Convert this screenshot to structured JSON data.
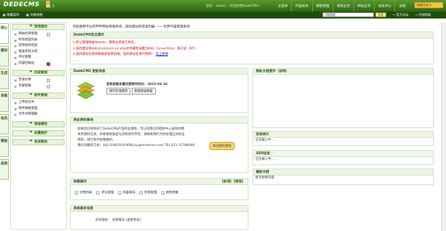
{
  "brand": {
    "logo": "DEDECMS",
    "version": "v5.7",
    "badge": "试用"
  },
  "top": {
    "welcome": "您好：admin，欢迎使用DedeCMS！",
    "nav": [
      "主菜单",
      "内容发布",
      "模板管理",
      "系统主页",
      "网站主页",
      "会员中心",
      "注销"
    ],
    "quick": "快捷方式"
  },
  "bar2": {
    "hide_menu": "隐藏菜单",
    "sitemap": "功能地图",
    "search_placeholder": "功能搜索",
    "search_btn": "搜索",
    "forum": "官方论坛",
    "help": "在线帮助"
  },
  "tabs": [
    "核心",
    "模块",
    "生成",
    "采集",
    "会员",
    "模板",
    "系统"
  ],
  "sidebar": {
    "groups": [
      {
        "title": "常用操作",
        "items": [
          "网站栏目管理",
          "所有档案列表",
          "等审核的档案",
          "我发布的文档",
          "评论管理",
          "内容回收站"
        ]
      },
      {
        "title": "内容管理",
        "items": [
          "普通文章",
          "专题管理"
        ]
      },
      {
        "title": "附件管理",
        "items": [
          "上传新文件",
          "附件数据管理",
          "文件式管理器"
        ]
      },
      {
        "title": "频道模型",
        "items": []
      },
      {
        "title": "批量维护",
        "items": []
      },
      {
        "title": "系统帮助",
        "items": []
      }
    ]
  },
  "main": {
    "welcome": "欢迎使用专业的PHP网站管理系统，轻松建站的首选利器 —— 织梦内容管理系统",
    "security": {
      "title": "DedeCMS安全提示",
      "lines": [
        "1.默认管理目录为dede，需要立即将它更名；",
        "2.强烈建议将data/common.inc.php文件属性设置为644（Linux/Unix）或只读（NT）；",
        "3.强烈建议您修改数据表名称前缀，强烈建议您进行更改！"
      ],
      "link": "马上修改"
    },
    "update": {
      "title": "DedeCMS 更新消息",
      "date_text": "您系统版本最后更新时间为：2015-06-18",
      "btn_update": "进行在线更新",
      "btn_fix": "系统错误修复"
    },
    "license": {
      "title": "商业授权查询",
      "lines": [
        "如果您已经购买了DedeCMS产品商业授权，可以在我们的授权中心查询到相",
        "关的授权信息，如果授权类型与您购买的不符，请联系我们为你办理正式商业",
        "授权，进行及时处理维护。",
        "我们的联系方式：QQ:10387919 MSN:jsy@dedecms.com TEL:021-37788569"
      ],
      "btn": "商业授权查询"
    },
    "quick": {
      "title": "快捷操作",
      "actions": "【新增】【管理】",
      "links": [
        "文档列表",
        "评论管理",
        "内容发布",
        "栏目管理",
        "修改参数"
      ]
    },
    "sysinfo": {
      "title": "系统基本信息",
      "line": "您的级别： 总管理员 [查看更多]"
    },
    "right": {
      "help_title": "帮助文档提示（说明）",
      "stats_title": "信息统计",
      "stats_text": "正在载入中...",
      "sys_title": "SEO信息",
      "sys_text": "正在载入中......",
      "latest_title": "最新文档",
      "latest_text": "暂无新增内容"
    }
  }
}
